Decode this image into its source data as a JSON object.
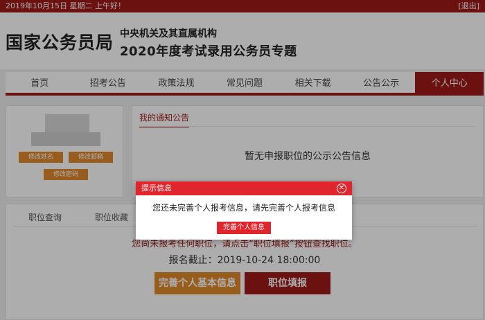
{
  "topbar": {
    "date_text": "2019年10月15日   星期二   上午好！",
    "logout_label": "[退出]"
  },
  "header": {
    "site_name": "国家公务员局",
    "line1": "中央机关及其直属机构",
    "line2": "2020年度考试录用公务员专题"
  },
  "nav": {
    "items": [
      {
        "label": "首页"
      },
      {
        "label": "招考公告"
      },
      {
        "label": "政策法规"
      },
      {
        "label": "常见问题"
      },
      {
        "label": "相关下载"
      },
      {
        "label": "公告公示"
      },
      {
        "label": "个人中心"
      }
    ],
    "active_index": 6
  },
  "profile": {
    "edit_name_label": "修改姓名",
    "edit_email_label": "修改邮箱",
    "edit_password_label": "修改密码"
  },
  "notice": {
    "tab_label": "我的通知公告",
    "empty_text": "暂无申报职位的公示公告信息"
  },
  "positions": {
    "tabs": [
      {
        "label": "职位查询"
      },
      {
        "label": "职位收藏"
      }
    ],
    "warning_text": "您尚未报考任何职位，请点击“职位填报”按钮查找职位。",
    "deadline_text": "报名截止：2019-10-24 18:00:00",
    "complete_info_label": "完善个人基本信息",
    "fill_position_label": "职位填报"
  },
  "modal": {
    "title": "提示信息",
    "message": "您还未完善个人报考信息，请先完善个人报考信息",
    "button_label": "完善个人信息",
    "close_icon": "close-circle-icon"
  },
  "colors": {
    "brand_red": "#9e1b18",
    "modal_red": "#e0262c",
    "orange": "#e08a2b"
  }
}
